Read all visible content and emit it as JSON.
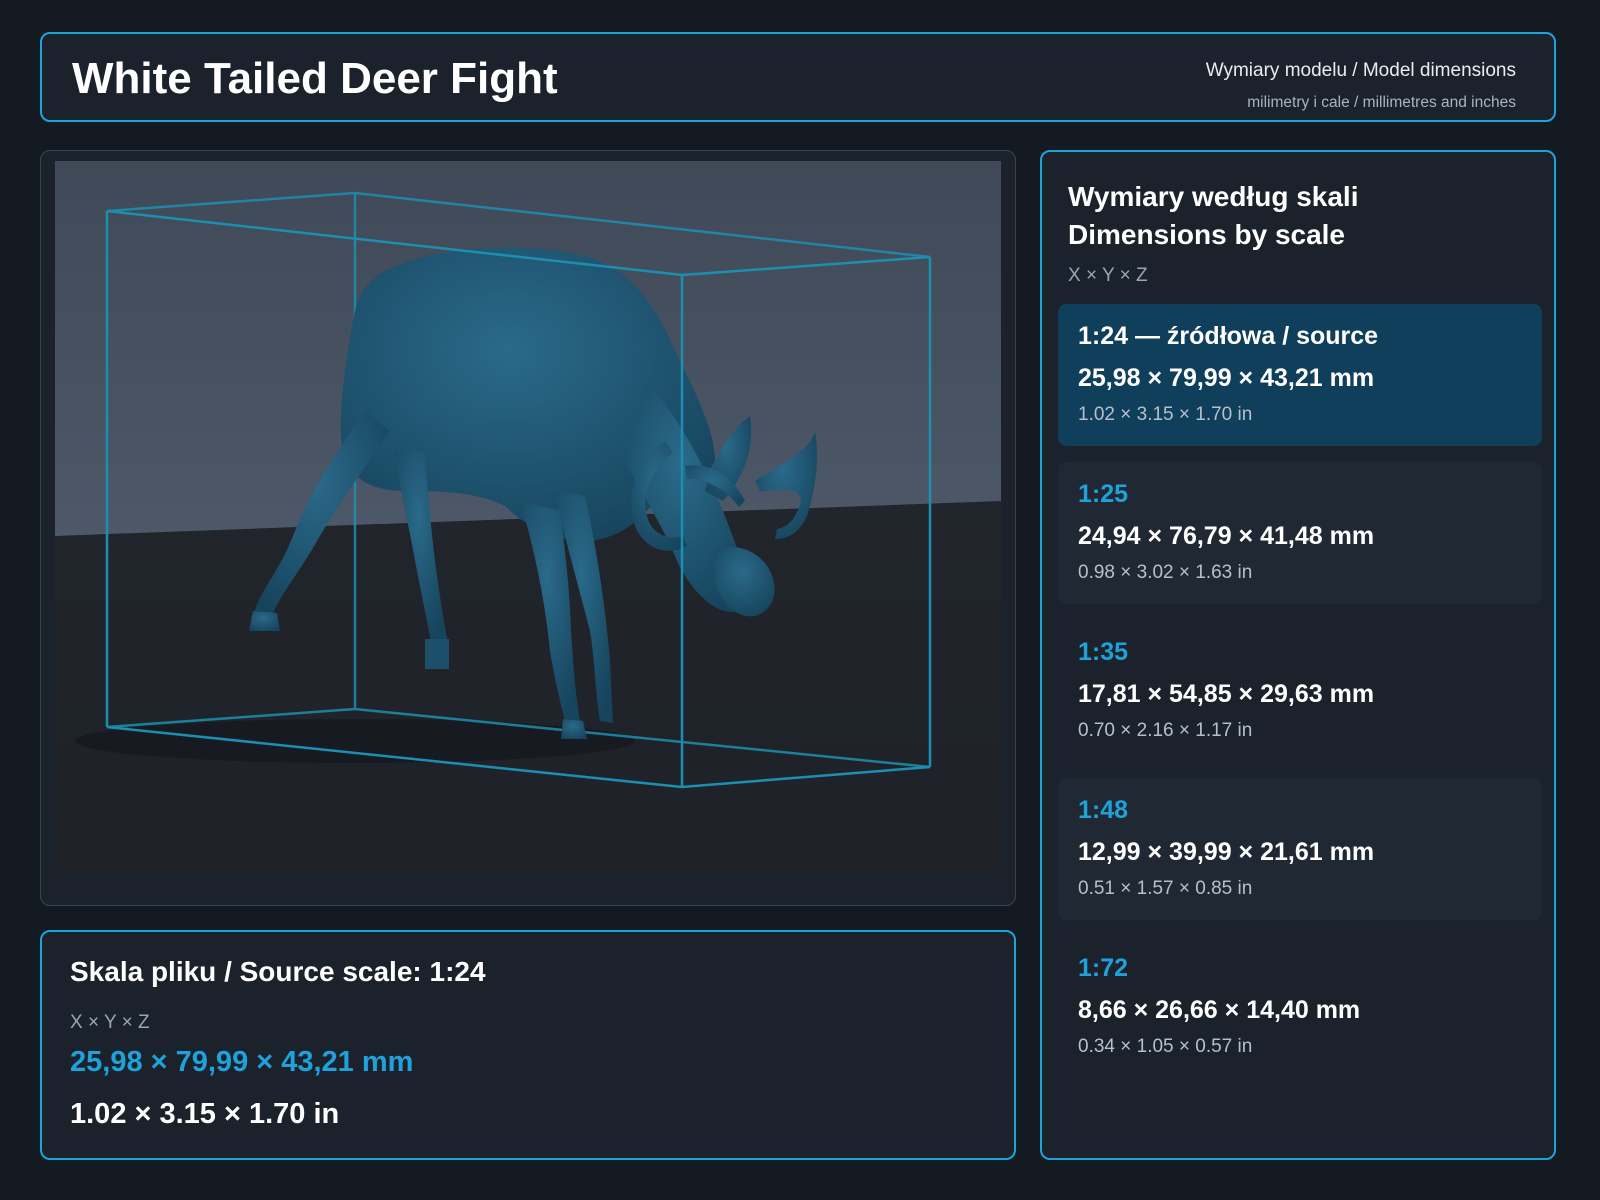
{
  "header": {
    "title": "White Tailed Deer Fight",
    "subtitle": "Wymiary modelu / Model dimensions",
    "units_note": "milimetry i cale / millimetres and inches"
  },
  "source_panel": {
    "title": "Skala pliku / Source scale: 1:24",
    "axes": "X × Y × Z",
    "mm": "25,98 × 79,99 × 43,21 mm",
    "inches": "1.02 × 3.15 × 1.70 in"
  },
  "scales_panel": {
    "title_pl": "Wymiary według skali",
    "title_en": "Dimensions by scale",
    "axes": "X × Y × Z",
    "items": [
      {
        "label": "1:24  —  źródłowa / source",
        "mm": "25,98 × 79,99 × 43,21 mm",
        "inches": "1.02 × 3.15 × 1.70 in"
      },
      {
        "label": "1:25",
        "mm": "24,94 × 76,79 × 41,48 mm",
        "inches": "0.98 × 3.02 × 1.63 in"
      },
      {
        "label": "1:35",
        "mm": "17,81 × 54,85 × 29,63 mm",
        "inches": "0.70 × 2.16 × 1.17 in"
      },
      {
        "label": "1:48",
        "mm": "12,99 × 39,99 × 21,61 mm",
        "inches": "0.51 × 1.57 × 0.85 in"
      },
      {
        "label": "1:72",
        "mm": "8,66 × 26,66 × 14,40 mm",
        "inches": "0.34 × 1.05 × 0.57 in"
      }
    ]
  },
  "colors": {
    "accent": "#1fa2dc",
    "background": "#131a22",
    "panel": "#1b222c",
    "active_card": "#0f3f5b",
    "model": "#1f5470"
  },
  "icons": {
    "viewport": "3d-model-bounding-box"
  }
}
